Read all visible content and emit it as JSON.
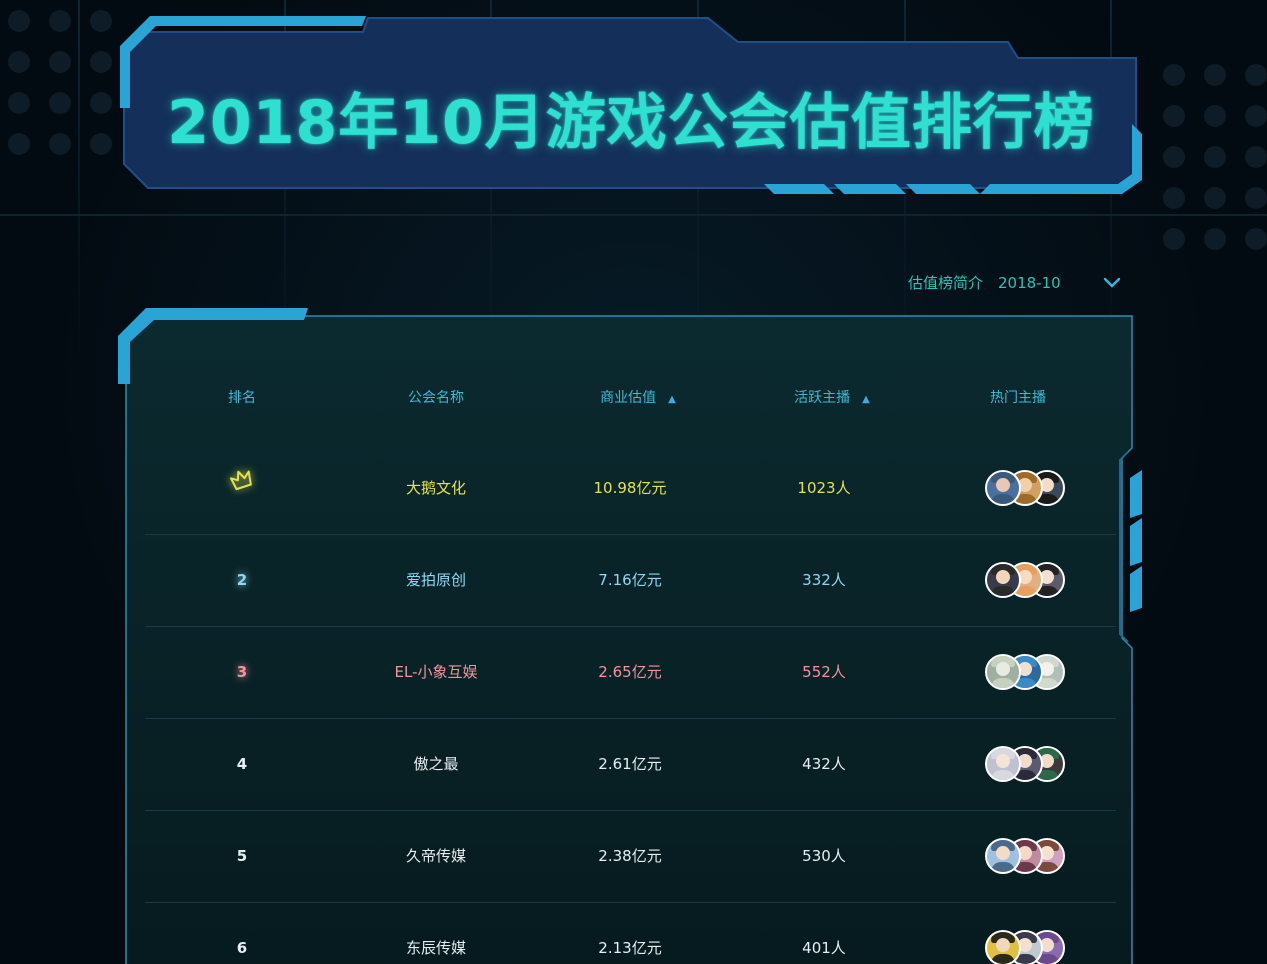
{
  "title": "2018年10月游戏公会估值排行榜",
  "intro_link": "估值榜简介",
  "period": "2018-10",
  "colors": {
    "accent_teal": "#2de0d0",
    "header_blue": "#3fb9d6",
    "frame_blue": "#2aa4d5",
    "banner_fill": "#14305a",
    "first": "#e4e34f",
    "second": "#8fd8f2",
    "third": "#f2949c",
    "default": "#e8eef2"
  },
  "table": {
    "headers": {
      "rank": "排名",
      "name": "公会名称",
      "valuation": "商业估值",
      "valuation_sort": "▲",
      "active": "活跃主播",
      "active_sort": "▲",
      "hot": "热门主播"
    },
    "rows": [
      {
        "rank": "",
        "rank_icon": "crown-icon",
        "name": "大鹅文化",
        "valuation": "10.98亿元",
        "active": "1023人",
        "tone": "first"
      },
      {
        "rank": "2",
        "name": "爱拍原创",
        "valuation": "7.16亿元",
        "active": "332人",
        "tone": "second"
      },
      {
        "rank": "3",
        "name": "EL-小象互娱",
        "valuation": "2.65亿元",
        "active": "552人",
        "tone": "third"
      },
      {
        "rank": "4",
        "name": "傲之最",
        "valuation": "2.61亿元",
        "active": "432人",
        "tone": "default"
      },
      {
        "rank": "5",
        "name": "久帝传媒",
        "valuation": "2.38亿元",
        "active": "530人",
        "tone": "default"
      },
      {
        "rank": "6",
        "name": "东辰传媒",
        "valuation": "2.13亿元",
        "active": "401人",
        "tone": "default"
      }
    ]
  }
}
